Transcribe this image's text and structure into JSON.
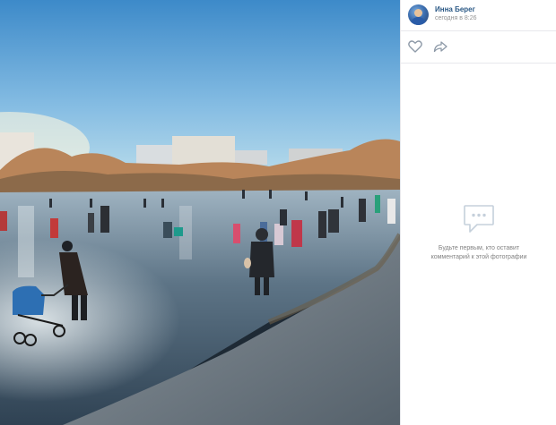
{
  "post": {
    "author": "Инна Берег",
    "time": "сегодня в 8:26"
  },
  "actions": {
    "like_icon": "heart-outline-icon",
    "share_icon": "share-arrow-icon"
  },
  "comments": {
    "empty_icon": "comment-bubble-icon",
    "empty_text": "Будьте первым, кто оставит комментарий к этой фотографии"
  },
  "colors": {
    "author_link": "#2a5885",
    "muted_text": "#939393",
    "divider": "#e7e8ec"
  }
}
